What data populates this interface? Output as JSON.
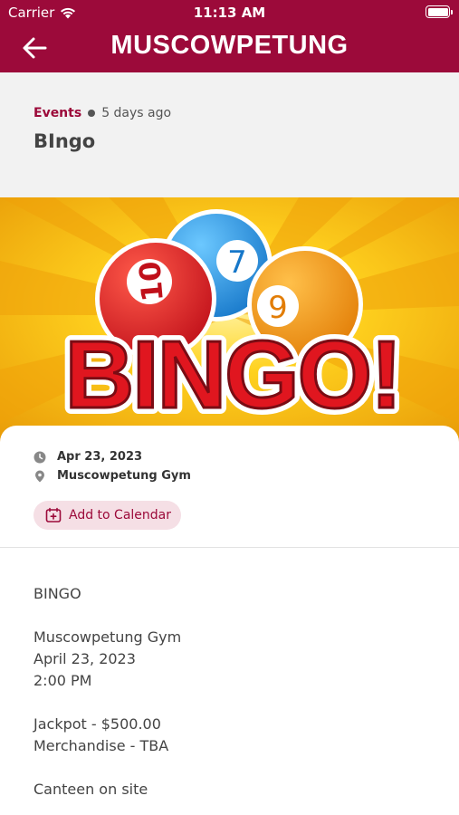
{
  "status": {
    "carrier": "Carrier",
    "time": "11:13 AM"
  },
  "nav": {
    "title": "MUSCOWPETUNG"
  },
  "post": {
    "category": "Events",
    "ago": "5 days ago",
    "title": "BIngo"
  },
  "banner": {
    "text": "BINGO!",
    "balls": [
      "10",
      "7",
      "9"
    ]
  },
  "event": {
    "date": "Apr 23, 2023",
    "location": "Muscowpetung Gym",
    "calendar_button": "Add to Calendar"
  },
  "description": {
    "p1": "BINGO",
    "p2": "Muscowpetung Gym\nApril 23, 2023\n2:00 PM",
    "p3": "Jackpot - $500.00\nMerchandise - TBA",
    "p4": "Canteen on site"
  },
  "colors": {
    "brand": "#9c0a3a",
    "calendar_bg": "#f5dfe5"
  }
}
